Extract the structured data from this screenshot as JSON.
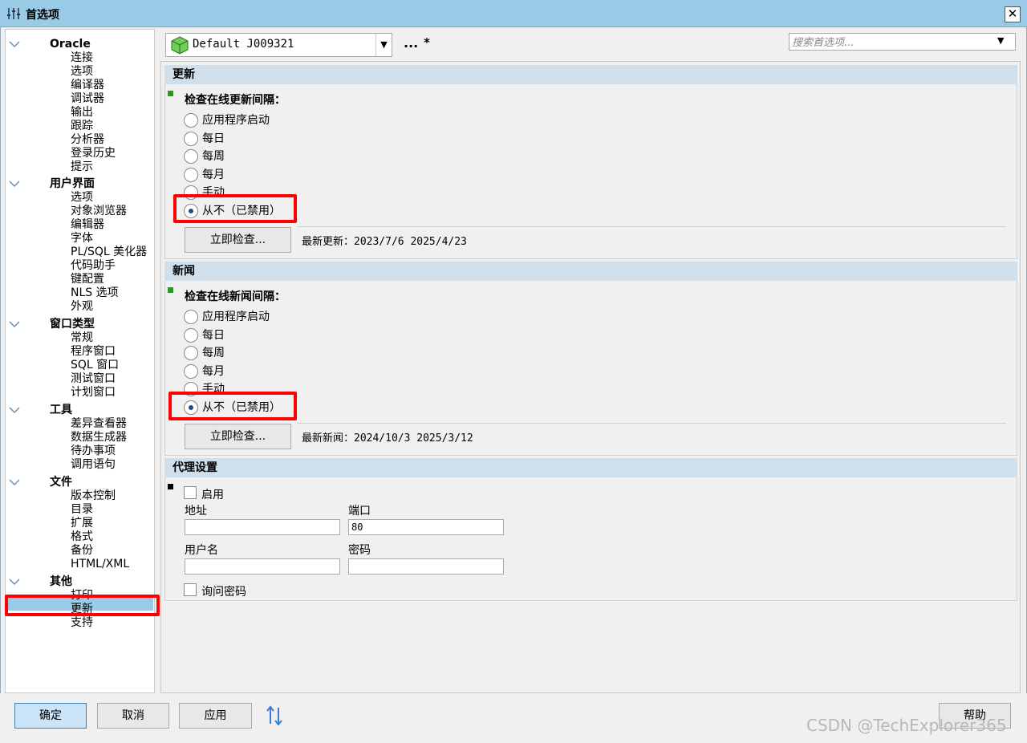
{
  "window": {
    "title": "首选项",
    "close": "✕"
  },
  "tree": {
    "groups": [
      {
        "label": "Oracle",
        "items": [
          "连接",
          "选项",
          "编译器",
          "调试器",
          "输出",
          "跟踪",
          "分析器",
          "登录历史",
          "提示"
        ]
      },
      {
        "label": "用户界面",
        "items": [
          "选项",
          "对象浏览器",
          "编辑器",
          "字体",
          "PL/SQL 美化器",
          "代码助手",
          "键配置",
          "NLS 选项",
          "外观"
        ]
      },
      {
        "label": "窗口类型",
        "items": [
          "常规",
          "程序窗口",
          "SQL 窗口",
          "测试窗口",
          "计划窗口"
        ]
      },
      {
        "label": "工具",
        "items": [
          "差异查看器",
          "数据生成器",
          "待办事项",
          "调用语句"
        ]
      },
      {
        "label": "文件",
        "items": [
          "版本控制",
          "目录",
          "扩展",
          "格式",
          "备份",
          "HTML/XML"
        ]
      },
      {
        "label": "其他",
        "items": [
          "打印",
          "更新",
          "支持"
        ]
      }
    ],
    "selected": "更新"
  },
  "toolbar": {
    "profile": "Default J009321",
    "dots": "...",
    "modified": "*",
    "search_placeholder": "搜索首选项..."
  },
  "update": {
    "header": "更新",
    "interval_label": "检查在线更新间隔：",
    "options": [
      "应用程序启动",
      "每日",
      "每周",
      "每月",
      "手动",
      "从不（已禁用）"
    ],
    "selected": "从不（已禁用）",
    "check_button": "立即检查...",
    "status": "最新更新：2023/7/6 2025/4/23"
  },
  "news": {
    "header": "新闻",
    "interval_label": "检查在线新闻间隔：",
    "options": [
      "应用程序启动",
      "每日",
      "每周",
      "每月",
      "手动",
      "从不（已禁用）"
    ],
    "selected": "从不（已禁用）",
    "check_button": "立即检查...",
    "status": "最新新闻：2024/10/3 2025/3/12"
  },
  "proxy": {
    "header": "代理设置",
    "enable_label": "启用",
    "address_label": "地址",
    "address_value": "",
    "port_label": "端口",
    "port_value": "80",
    "username_label": "用户名",
    "username_value": "",
    "password_label": "密码",
    "password_value": "",
    "ask_password_label": "询问密码"
  },
  "buttons": {
    "ok": "确定",
    "cancel": "取消",
    "apply": "应用",
    "help": "帮助"
  },
  "watermark": "CSDN @TechExplorer365",
  "colors": {
    "titlebar": "#99cbe6",
    "selection": "#99cbe6",
    "section_header": "#cfe0ec",
    "highlight_box": "#ff0000",
    "marker_green": "#1aa31a"
  }
}
